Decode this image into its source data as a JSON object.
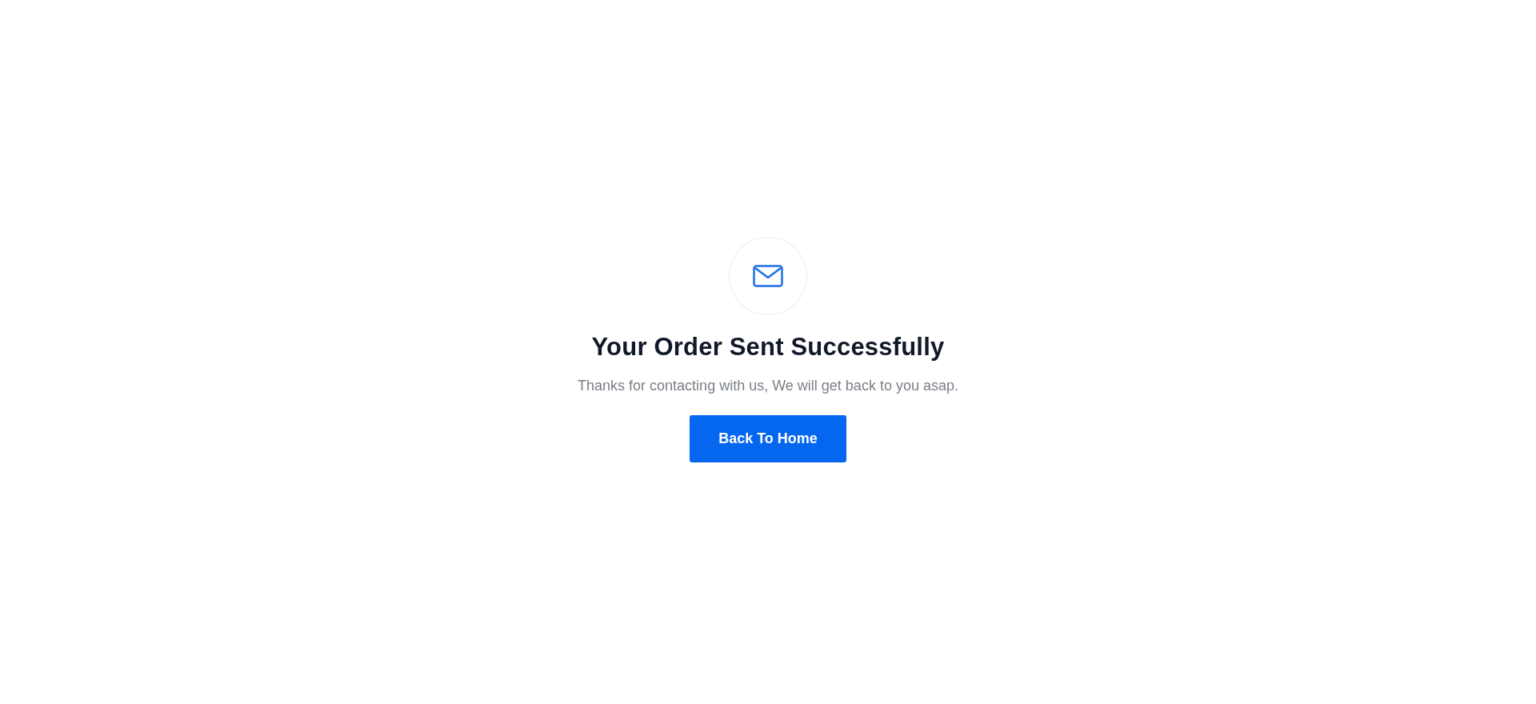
{
  "title": "Your Order Sent Successfully",
  "message": "Thanks for contacting with us, We will get back to you asap.",
  "button": {
    "label": "Back To Home"
  }
}
